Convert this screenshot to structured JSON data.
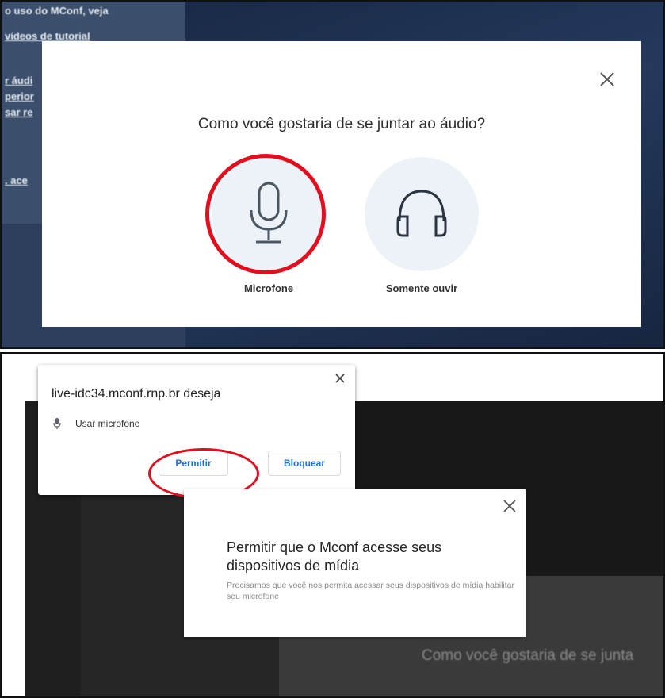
{
  "top": {
    "sidebar_lines": [
      "o uso do MConf, veja",
      "vídeos de tutorial",
      "r áudi",
      "perior",
      "sar re",
      ". ace"
    ],
    "audio_modal": {
      "title": "Como você gostaria de se juntar ao áudio?",
      "options": [
        {
          "label": "Microfone",
          "icon": "microphone-icon"
        },
        {
          "label": "Somente ouvir",
          "icon": "headphones-icon"
        }
      ],
      "close_icon": "close-icon"
    }
  },
  "bottom": {
    "permission_popup": {
      "title": "live-idc34.mconf.rnp.br deseja",
      "mic_label": "Usar microfone",
      "allow_label": "Permitir",
      "block_label": "Bloquear"
    },
    "media_modal": {
      "title": "Permitir que o Mconf acesse seus dispositivos de mídia",
      "description": "Precisamos que você nos permita acessar seus dispositivos de mídia habilitar seu microfone"
    },
    "background_heading": "Como você gostaria de se junta"
  },
  "colors": {
    "highlight_red": "#e10f1d",
    "button_blue": "#1a73e8",
    "option_bg": "#edf2f8",
    "dark_navy": "#1d2f4e"
  }
}
